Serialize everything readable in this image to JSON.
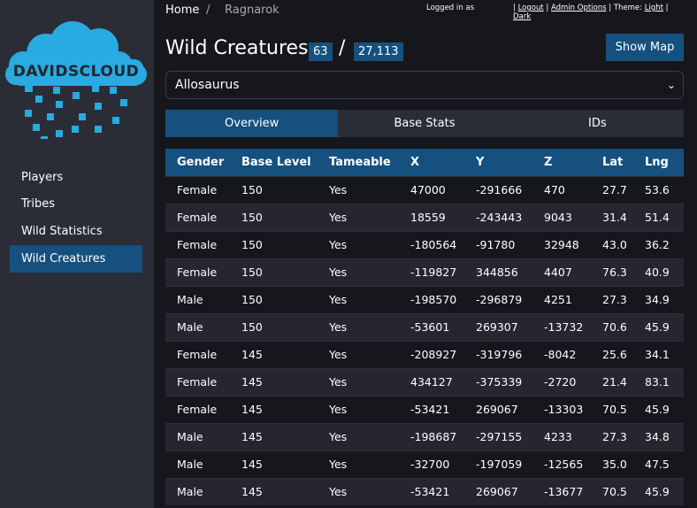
{
  "logo": {
    "text": "DAVIDSCLOUD",
    "color": "#29aae1"
  },
  "sidebar": {
    "items": [
      {
        "label": "Players"
      },
      {
        "label": "Tribes"
      },
      {
        "label": "Wild Statistics"
      },
      {
        "label": "Wild Creatures",
        "active": true
      }
    ]
  },
  "breadcrumb": {
    "home": "Home",
    "sep": "/",
    "current": "Ragnarok"
  },
  "topbar": {
    "logged_in": "Logged in as",
    "sep": "|",
    "logout": "Logout",
    "admin": "Admin Options",
    "theme": "Theme:",
    "light": "Light",
    "dark": "Dark"
  },
  "header": {
    "title": "Wild Creatures",
    "count": "63",
    "sep": "/",
    "total": "27,113",
    "show_map": "Show Map"
  },
  "select": {
    "value": "Allosaurus"
  },
  "tabs": [
    {
      "label": "Overview",
      "active": true
    },
    {
      "label": "Base Stats"
    },
    {
      "label": "IDs"
    }
  ],
  "table": {
    "columns": [
      "Gender",
      "Base Level",
      "Tameable",
      "X",
      "Y",
      "Z",
      "Lat",
      "Lng"
    ],
    "rows": [
      [
        "Female",
        "150",
        "Yes",
        "47000",
        "-291666",
        "470",
        "27.7",
        "53.6"
      ],
      [
        "Female",
        "150",
        "Yes",
        "18559",
        "-243443",
        "9043",
        "31.4",
        "51.4"
      ],
      [
        "Female",
        "150",
        "Yes",
        "-180564",
        "-91780",
        "32948",
        "43.0",
        "36.2"
      ],
      [
        "Female",
        "150",
        "Yes",
        "-119827",
        "344856",
        "4407",
        "76.3",
        "40.9"
      ],
      [
        "Male",
        "150",
        "Yes",
        "-198570",
        "-296879",
        "4251",
        "27.3",
        "34.9"
      ],
      [
        "Male",
        "150",
        "Yes",
        "-53601",
        "269307",
        "-13732",
        "70.6",
        "45.9"
      ],
      [
        "Female",
        "145",
        "Yes",
        "-208927",
        "-319796",
        "-8042",
        "25.6",
        "34.1"
      ],
      [
        "Female",
        "145",
        "Yes",
        "434127",
        "-375339",
        "-2720",
        "21.4",
        "83.1"
      ],
      [
        "Female",
        "145",
        "Yes",
        "-53421",
        "269067",
        "-13303",
        "70.5",
        "45.9"
      ],
      [
        "Male",
        "145",
        "Yes",
        "-198687",
        "-297155",
        "4233",
        "27.3",
        "34.8"
      ],
      [
        "Male",
        "145",
        "Yes",
        "-32700",
        "-197059",
        "-12565",
        "35.0",
        "47.5"
      ],
      [
        "Male",
        "145",
        "Yes",
        "-53421",
        "269067",
        "-13677",
        "70.5",
        "45.9"
      ]
    ]
  }
}
